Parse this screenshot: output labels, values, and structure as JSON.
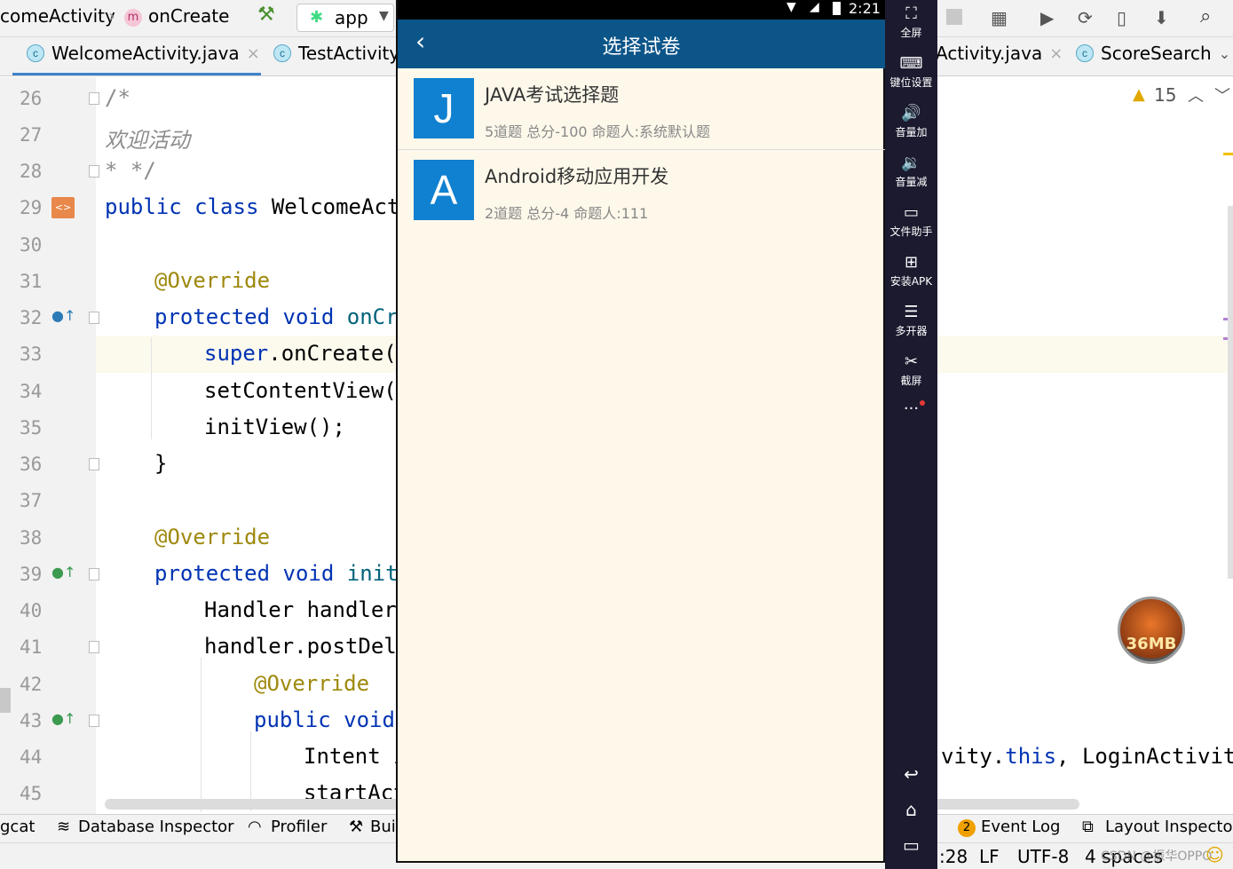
{
  "ide": {
    "breadcrumb": {
      "activity": "comeActivity",
      "method_badge": "m",
      "method": "onCreate",
      "config": "app"
    },
    "tabs": [
      {
        "badge": "c",
        "label": "WelcomeActivity.java",
        "close": "×"
      },
      {
        "badge": "c",
        "label": "TestActivity"
      },
      {
        "label": "Activity.java",
        "close": "×"
      },
      {
        "badge": "c",
        "label": "ScoreSearch"
      }
    ],
    "inspection": {
      "count": "15"
    },
    "lines": [
      {
        "n": "26"
      },
      {
        "n": "27"
      },
      {
        "n": "28"
      },
      {
        "n": "29"
      },
      {
        "n": "30"
      },
      {
        "n": "31"
      },
      {
        "n": "32"
      },
      {
        "n": "33"
      },
      {
        "n": "34"
      },
      {
        "n": "35"
      },
      {
        "n": "36"
      },
      {
        "n": "37"
      },
      {
        "n": "38"
      },
      {
        "n": "39"
      },
      {
        "n": "40"
      },
      {
        "n": "41"
      },
      {
        "n": "42"
      },
      {
        "n": "43"
      },
      {
        "n": "44"
      },
      {
        "n": "45"
      }
    ],
    "code": {
      "l26": "/*",
      "l27": "欢迎活动",
      "l28": "* */",
      "l29_kw": "public class ",
      "l29_rest": "WelcomeActi",
      "l31": "@Override",
      "l32_kw": "protected void ",
      "l32_fn": "onCre",
      "l33_kw": "super",
      "l33_rest": ".onCreate(s",
      "l34": "setContentView(R",
      "l35": "initView();",
      "l36": "}",
      "l38": "@Override",
      "l39_kw": "protected void ",
      "l39_fn": "initV",
      "l40": "Handler handler",
      "l41": "handler.postDela",
      "l42": "@Override",
      "l43_kw": "public void",
      "l44": "Intent i",
      "l44_right_pre": "vity.",
      "l44_right_kw": "this",
      "l44_right_post": ", LoginActivity",
      "l45": "startAct"
    },
    "bottom_tools": [
      "gcat",
      "Database Inspector",
      "Profiler",
      "Bui",
      "Event Log",
      "Layout Inspector"
    ],
    "event_badge": "2",
    "status": {
      "pos": ":28",
      "sep": "LF",
      "enc": "UTF-8",
      "indent": "4 spaces",
      "watermark": "CSDN @振华OPPO"
    }
  },
  "phone": {
    "time": "2:21",
    "title": "选择试卷",
    "items": [
      {
        "letter": "J",
        "title": "JAVA考试选择题",
        "sub": "5道题 总分-100 命题人:系统默认题"
      },
      {
        "letter": "A",
        "title": "Android移动应用开发",
        "sub": "2道题 总分-4 命题人:111"
      }
    ]
  },
  "emulator": {
    "buttons": [
      {
        "icon": "fullscreen-icon",
        "glyph": "⛶",
        "label": "全屏"
      },
      {
        "icon": "keyboard-icon",
        "glyph": "⌨",
        "label": "键位设置"
      },
      {
        "icon": "volume-up-icon",
        "glyph": "🔊",
        "label": "音量加"
      },
      {
        "icon": "volume-down-icon",
        "glyph": "🔉",
        "label": "音量减"
      },
      {
        "icon": "file-icon",
        "glyph": "▭",
        "label": "文件助手"
      },
      {
        "icon": "apk-icon",
        "glyph": "⊞",
        "label": "安装APK"
      },
      {
        "icon": "multi-icon",
        "glyph": "☰",
        "label": "多开器"
      },
      {
        "icon": "scissors-icon",
        "glyph": "✂",
        "label": "截屏"
      }
    ],
    "more": "···"
  },
  "ram": {
    "value": "36MB"
  },
  "colors": {
    "phone_bar": "#0c5589",
    "avatar": "#1080d0",
    "emu_sidebar": "#1b1a2f",
    "keyword": "#0033b3",
    "annotation": "#9e880d"
  }
}
